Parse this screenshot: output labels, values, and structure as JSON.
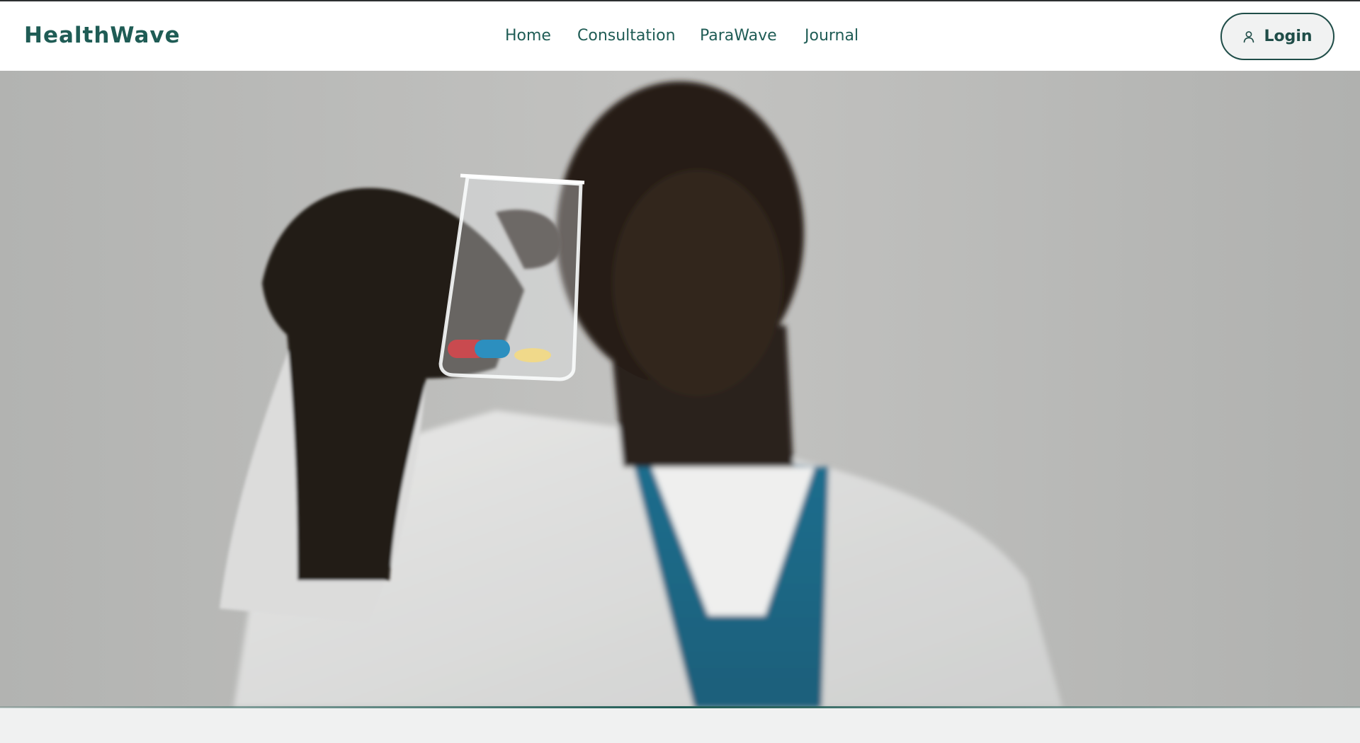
{
  "brand": {
    "name": "HealthWave",
    "color": "#1f5c55"
  },
  "nav": {
    "items": [
      {
        "label": "Home"
      },
      {
        "label": "Consultation"
      },
      {
        "label": "ParaWave"
      },
      {
        "label": "Journal"
      }
    ]
  },
  "login": {
    "label": "Login",
    "icon": "user-icon"
  },
  "hero": {
    "image": "doctor-holding-beaker-with-pills-photo"
  }
}
